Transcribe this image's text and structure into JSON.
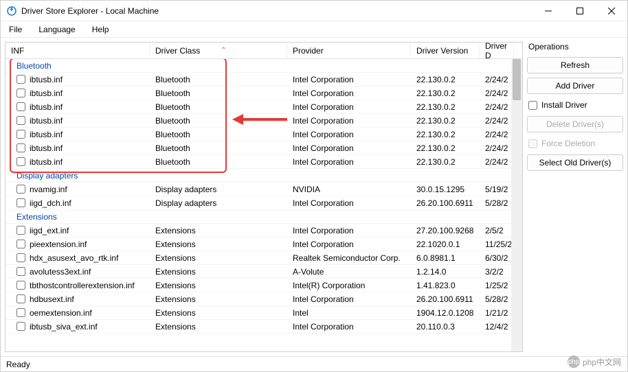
{
  "window": {
    "title": "Driver Store Explorer - Local Machine"
  },
  "menu": {
    "file": "File",
    "language": "Language",
    "help": "Help"
  },
  "columns": {
    "inf": "INF",
    "class": "Driver Class",
    "provider": "Provider",
    "version": "Driver Version",
    "date": "Driver D"
  },
  "operations": {
    "label": "Operations",
    "refresh": "Refresh",
    "add_driver": "Add Driver",
    "install_driver": "Install Driver",
    "delete_drivers": "Delete Driver(s)",
    "force_deletion": "Force Deletion",
    "select_old": "Select Old Driver(s)"
  },
  "groups": [
    {
      "name": "Bluetooth",
      "rows": [
        {
          "inf": "ibtusb.inf",
          "class": "Bluetooth",
          "provider": "Intel Corporation",
          "version": "22.130.0.2",
          "date": "2/24/2"
        },
        {
          "inf": "ibtusb.inf",
          "class": "Bluetooth",
          "provider": "Intel Corporation",
          "version": "22.130.0.2",
          "date": "2/24/2"
        },
        {
          "inf": "ibtusb.inf",
          "class": "Bluetooth",
          "provider": "Intel Corporation",
          "version": "22.130.0.2",
          "date": "2/24/2"
        },
        {
          "inf": "ibtusb.inf",
          "class": "Bluetooth",
          "provider": "Intel Corporation",
          "version": "22.130.0.2",
          "date": "2/24/2"
        },
        {
          "inf": "ibtusb.inf",
          "class": "Bluetooth",
          "provider": "Intel Corporation",
          "version": "22.130.0.2",
          "date": "2/24/2"
        },
        {
          "inf": "ibtusb.inf",
          "class": "Bluetooth",
          "provider": "Intel Corporation",
          "version": "22.130.0.2",
          "date": "2/24/2"
        },
        {
          "inf": "ibtusb.inf",
          "class": "Bluetooth",
          "provider": "Intel Corporation",
          "version": "22.130.0.2",
          "date": "2/24/2"
        }
      ]
    },
    {
      "name": "Display adapters",
      "rows": [
        {
          "inf": "nvamig.inf",
          "class": "Display adapters",
          "provider": "NVIDIA",
          "version": "30.0.15.1295",
          "date": "5/19/2"
        },
        {
          "inf": "iigd_dch.inf",
          "class": "Display adapters",
          "provider": "Intel Corporation",
          "version": "26.20.100.6911",
          "date": "5/28/2"
        }
      ]
    },
    {
      "name": "Extensions",
      "rows": [
        {
          "inf": "iigd_ext.inf",
          "class": "Extensions",
          "provider": "Intel Corporation",
          "version": "27.20.100.9268",
          "date": "2/5/2"
        },
        {
          "inf": "pieextension.inf",
          "class": "Extensions",
          "provider": "Intel Corporation",
          "version": "22.1020.0.1",
          "date": "11/25/2"
        },
        {
          "inf": "hdx_asusext_avo_rtk.inf",
          "class": "Extensions",
          "provider": "Realtek Semiconductor Corp.",
          "version": "6.0.8981.1",
          "date": "6/30/2"
        },
        {
          "inf": "avolutess3ext.inf",
          "class": "Extensions",
          "provider": "A-Volute",
          "version": "1.2.14.0",
          "date": "3/2/2"
        },
        {
          "inf": "tbthostcontrollerextension.inf",
          "class": "Extensions",
          "provider": "Intel(R) Corporation",
          "version": "1.41.823.0",
          "date": "1/25/2"
        },
        {
          "inf": "hdbusext.inf",
          "class": "Extensions",
          "provider": "Intel Corporation",
          "version": "26.20.100.6911",
          "date": "5/28/2"
        },
        {
          "inf": "oemextension.inf",
          "class": "Extensions",
          "provider": "Intel",
          "version": "1904.12.0.1208",
          "date": "1/21/2"
        },
        {
          "inf": "ibtusb_siva_ext.inf",
          "class": "Extensions",
          "provider": "Intel Corporation",
          "version": "20.110.0.3",
          "date": "12/4/2"
        }
      ]
    }
  ],
  "status": "Ready",
  "watermark": "php中文网"
}
